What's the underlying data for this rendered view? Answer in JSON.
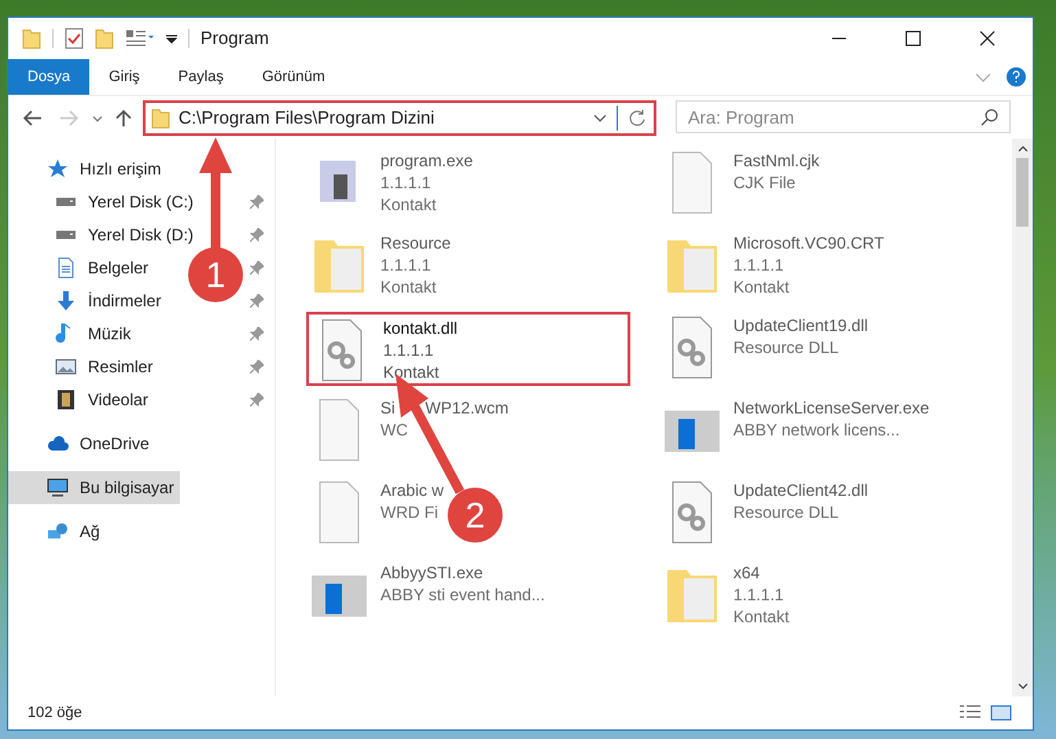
{
  "window": {
    "title": "Program"
  },
  "ribbon_tabs": [
    {
      "label": "Dosya",
      "selected": true
    },
    {
      "label": "Giriş",
      "selected": false
    },
    {
      "label": "Paylaş",
      "selected": false
    },
    {
      "label": "Görünüm",
      "selected": false
    }
  ],
  "address": {
    "value": "C:\\Program Files\\Program Dizini",
    "highlighted": true
  },
  "search": {
    "placeholder": "Ara: Program"
  },
  "sidebar": {
    "items": [
      {
        "label": "Hızlı erişim",
        "kind": "star",
        "pinned": false,
        "selected": false,
        "children": [
          {
            "label": "Yerel Disk (C:)",
            "kind": "drive",
            "pinned": true,
            "selected": false
          },
          {
            "label": "Yerel Disk (D:)",
            "kind": "drive",
            "pinned": true,
            "selected": false
          },
          {
            "label": "Belgeler",
            "kind": "document",
            "pinned": true,
            "selected": false
          },
          {
            "label": "İndirmeler",
            "kind": "download",
            "pinned": true,
            "selected": false
          },
          {
            "label": "Müzik",
            "kind": "music",
            "pinned": true,
            "selected": false
          },
          {
            "label": "Resimler",
            "kind": "picture",
            "pinned": true,
            "selected": false
          },
          {
            "label": "Videolar",
            "kind": "video",
            "pinned": true,
            "selected": false
          }
        ]
      },
      {
        "label": "OneDrive",
        "kind": "cloud",
        "pinned": false,
        "selected": false
      },
      {
        "label": "Bu bilgisayar",
        "kind": "computer",
        "pinned": false,
        "selected": true
      },
      {
        "label": "Ağ",
        "kind": "network",
        "pinned": false,
        "selected": false
      }
    ]
  },
  "files": [
    {
      "name": "program.exe",
      "lines": [
        "1.1.1.1",
        "Kontakt"
      ],
      "kind": "exe",
      "blurred": true,
      "highlighted": false
    },
    {
      "name": "FastNml.cjk",
      "lines": [
        "CJK File"
      ],
      "kind": "file",
      "blurred": true,
      "highlighted": false
    },
    {
      "name": "Resource",
      "lines": [
        "1.1.1.1",
        "Kontakt"
      ],
      "kind": "folder",
      "blurred": true,
      "highlighted": false
    },
    {
      "name": "Microsoft.VC90.CRT",
      "lines": [
        "1.1.1.1",
        "Kontakt"
      ],
      "kind": "folder",
      "blurred": true,
      "highlighted": false
    },
    {
      "name": "kontakt.dll",
      "lines": [
        "1.1.1.1",
        "Kontakt"
      ],
      "kind": "dll",
      "blurred": false,
      "highlighted": true
    },
    {
      "name": "UpdateClient19.dll",
      "lines": [
        "Resource DLL"
      ],
      "kind": "dll",
      "blurred": true,
      "highlighted": false
    },
    {
      "name": "Si",
      "name_end": "WP12.wcm",
      "lines": [
        "WC"
      ],
      "kind": "file",
      "blurred": true,
      "highlighted": false
    },
    {
      "name": "NetworkLicenseServer.exe",
      "lines": [
        "ABBY network licens..."
      ],
      "kind": "app",
      "blurred": true,
      "highlighted": false
    },
    {
      "name": "Arabic w",
      "lines": [
        "WRD Fi"
      ],
      "kind": "file",
      "blurred": true,
      "highlighted": false
    },
    {
      "name": "UpdateClient42.dll",
      "lines": [
        "Resource DLL"
      ],
      "kind": "dll",
      "blurred": true,
      "highlighted": false
    },
    {
      "name": "AbbyySTI.exe",
      "lines": [
        "ABBY sti event hand..."
      ],
      "kind": "app",
      "blurred": true,
      "highlighted": false
    },
    {
      "name": "x64",
      "lines": [
        "1.1.1.1",
        "Kontakt"
      ],
      "kind": "folder",
      "blurred": true,
      "highlighted": false
    }
  ],
  "callouts": [
    {
      "number": "1"
    },
    {
      "number": "2"
    }
  ],
  "status_bar": {
    "count": "102 öğe"
  }
}
